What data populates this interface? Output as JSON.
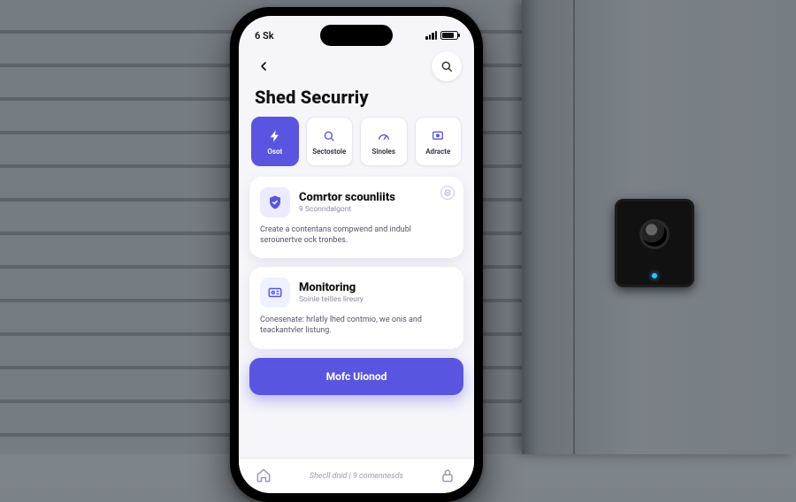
{
  "statusbar": {
    "time": "6 Sk"
  },
  "page": {
    "title": "Shed Securriy"
  },
  "chips": [
    {
      "icon": "bolt",
      "label": "Osot"
    },
    {
      "icon": "search",
      "label": "Sectostole"
    },
    {
      "icon": "gauge",
      "label": "Sinoles"
    },
    {
      "icon": "device",
      "label": "Adracte"
    }
  ],
  "cards": [
    {
      "icon": "shield-check",
      "title": "Comrtor scounliits",
      "subtitle": "9 Sconndalgont",
      "body": "Create a contentans compwend and indubl serounertve ock tronbes."
    },
    {
      "icon": "id-card",
      "title": "Monitoring",
      "subtitle": "Soinle teilles lireury",
      "body": "Conesenate: hrlatly lhed contmio, we onis and teackantvler listung."
    }
  ],
  "cta": {
    "label": "Mofc Uionod"
  },
  "footer": {
    "text": "Shecll dnid | 9 comennesds"
  },
  "colors": {
    "accent": "#5a55e0"
  }
}
